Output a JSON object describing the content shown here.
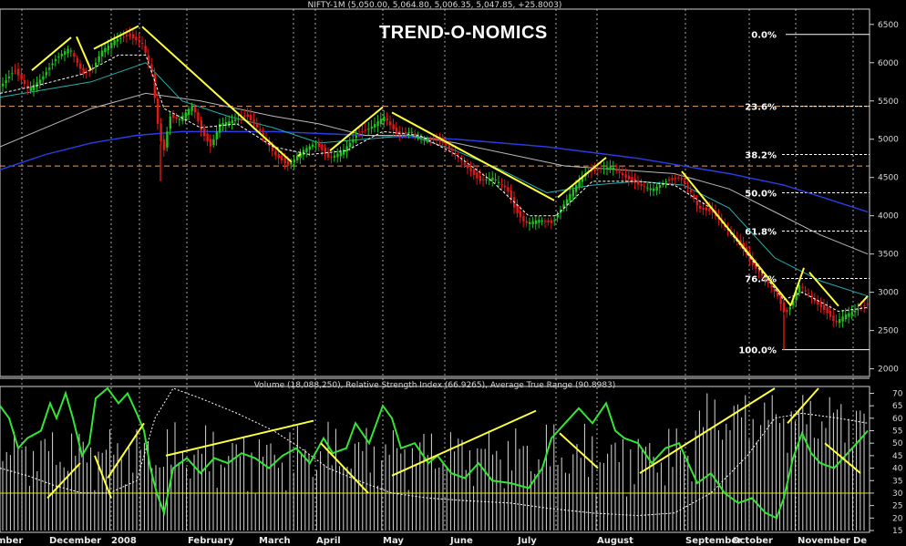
{
  "header": {
    "title": "NIFTY-1M (5,050.00, 5,064.80, 5,006.35, 5,047.85, +25.8003)",
    "brand": "TREND-O-NOMICS"
  },
  "chart_data": [
    {
      "type": "candlestick",
      "name": "price-panel",
      "ylim": [
        1900,
        6700
      ],
      "yticks": [
        2000,
        2500,
        3000,
        3500,
        4000,
        4500,
        5000,
        5500,
        6000,
        6500
      ],
      "x_labels": [
        "mber",
        "December",
        "2008",
        "February",
        "March",
        "April",
        "May",
        "June",
        "July",
        "August",
        "September",
        "October",
        "November",
        "De"
      ],
      "price_path": [
        [
          0,
          5700
        ],
        [
          15,
          5900
        ],
        [
          30,
          5650
        ],
        [
          45,
          5800
        ],
        [
          60,
          6050
        ],
        [
          75,
          6200
        ],
        [
          90,
          5850
        ],
        [
          100,
          5900
        ],
        [
          110,
          6150
        ],
        [
          125,
          6300
        ],
        [
          140,
          6350
        ],
        [
          155,
          6250
        ],
        [
          165,
          5900
        ],
        [
          172,
          5200
        ],
        [
          178,
          4800
        ],
        [
          185,
          5300
        ],
        [
          195,
          5250
        ],
        [
          210,
          5450
        ],
        [
          220,
          5100
        ],
        [
          230,
          4900
        ],
        [
          240,
          5200
        ],
        [
          255,
          5250
        ],
        [
          270,
          5300
        ],
        [
          285,
          5100
        ],
        [
          300,
          4800
        ],
        [
          315,
          4650
        ],
        [
          330,
          4850
        ],
        [
          345,
          4950
        ],
        [
          360,
          4750
        ],
        [
          375,
          4850
        ],
        [
          390,
          5050
        ],
        [
          405,
          5150
        ],
        [
          420,
          5300
        ],
        [
          435,
          5050
        ],
        [
          450,
          5100
        ],
        [
          465,
          5000
        ],
        [
          480,
          5000
        ],
        [
          495,
          4850
        ],
        [
          510,
          4650
        ],
        [
          525,
          4450
        ],
        [
          540,
          4500
        ],
        [
          555,
          4350
        ],
        [
          565,
          4050
        ],
        [
          575,
          3900
        ],
        [
          590,
          3950
        ],
        [
          605,
          3900
        ],
        [
          615,
          4100
        ],
        [
          625,
          4300
        ],
        [
          640,
          4550
        ],
        [
          655,
          4600
        ],
        [
          670,
          4650
        ],
        [
          685,
          4500
        ],
        [
          700,
          4400
        ],
        [
          715,
          4350
        ],
        [
          730,
          4450
        ],
        [
          745,
          4500
        ],
        [
          755,
          4350
        ],
        [
          765,
          4100
        ],
        [
          780,
          4050
        ],
        [
          795,
          3850
        ],
        [
          810,
          3650
        ],
        [
          825,
          3350
        ],
        [
          840,
          3150
        ],
        [
          852,
          2950
        ],
        [
          860,
          2700
        ],
        [
          868,
          2850
        ],
        [
          875,
          3100
        ],
        [
          885,
          3000
        ],
        [
          895,
          2850
        ],
        [
          905,
          2750
        ],
        [
          915,
          2600
        ],
        [
          925,
          2700
        ],
        [
          935,
          2750
        ],
        [
          945,
          2800
        ],
        [
          952,
          2850
        ]
      ],
      "lows": [
        [
          176,
          4450
        ],
        [
          860,
          2250
        ]
      ],
      "ma_short": [
        [
          0,
          5600
        ],
        [
          40,
          5700
        ],
        [
          90,
          5850
        ],
        [
          130,
          6100
        ],
        [
          160,
          6100
        ],
        [
          180,
          5400
        ],
        [
          220,
          5150
        ],
        [
          260,
          5200
        ],
        [
          300,
          4900
        ],
        [
          340,
          4800
        ],
        [
          380,
          4850
        ],
        [
          420,
          5100
        ],
        [
          460,
          5050
        ],
        [
          500,
          4800
        ],
        [
          540,
          4450
        ],
        [
          580,
          4000
        ],
        [
          610,
          4000
        ],
        [
          650,
          4450
        ],
        [
          700,
          4450
        ],
        [
          740,
          4400
        ],
        [
          780,
          4100
        ],
        [
          820,
          3500
        ],
        [
          860,
          2900
        ],
        [
          880,
          3000
        ],
        [
          920,
          2750
        ],
        [
          952,
          2800
        ]
      ],
      "ma_medium": [
        [
          0,
          5550
        ],
        [
          50,
          5650
        ],
        [
          100,
          5750
        ],
        [
          160,
          6000
        ],
        [
          200,
          5500
        ],
        [
          250,
          5300
        ],
        [
          300,
          5150
        ],
        [
          350,
          4950
        ],
        [
          400,
          5000
        ],
        [
          450,
          5050
        ],
        [
          500,
          4850
        ],
        [
          550,
          4600
        ],
        [
          600,
          4300
        ],
        [
          650,
          4400
        ],
        [
          700,
          4450
        ],
        [
          750,
          4400
        ],
        [
          800,
          4100
        ],
        [
          850,
          3450
        ],
        [
          900,
          3150
        ],
        [
          952,
          2950
        ]
      ],
      "ma_long": [
        [
          0,
          4900
        ],
        [
          50,
          5150
        ],
        [
          100,
          5400
        ],
        [
          160,
          5600
        ],
        [
          220,
          5500
        ],
        [
          300,
          5300
        ],
        [
          350,
          5200
        ],
        [
          400,
          5050
        ],
        [
          450,
          5050
        ],
        [
          500,
          4950
        ],
        [
          560,
          4800
        ],
        [
          620,
          4650
        ],
        [
          680,
          4600
        ],
        [
          740,
          4550
        ],
        [
          800,
          4350
        ],
        [
          850,
          4050
        ],
        [
          900,
          3750
        ],
        [
          952,
          3500
        ]
      ],
      "ma_blue": [
        [
          0,
          4600
        ],
        [
          50,
          4800
        ],
        [
          100,
          4950
        ],
        [
          150,
          5050
        ],
        [
          200,
          5100
        ],
        [
          300,
          5100
        ],
        [
          400,
          5050
        ],
        [
          500,
          5000
        ],
        [
          600,
          4900
        ],
        [
          700,
          4750
        ],
        [
          800,
          4550
        ],
        [
          860,
          4400
        ],
        [
          900,
          4250
        ],
        [
          952,
          4050
        ]
      ],
      "fib_levels": [
        {
          "label": "0.0%",
          "price": 6370
        },
        {
          "label": "23.6%",
          "price": 5430
        },
        {
          "label": "38.2%",
          "price": 4800
        },
        {
          "label": "50.0%",
          "price": 4300
        },
        {
          "label": "61.8%",
          "price": 3800
        },
        {
          "label": "76.4%",
          "price": 3180
        },
        {
          "label": "100.0%",
          "price": 2250
        }
      ],
      "dashed_levels": [
        5430,
        4650
      ],
      "trendlines": [
        [
          [
            35,
            5900
          ],
          [
            78,
            6330
          ]
        ],
        [
          [
            84,
            6340
          ],
          [
            100,
            5900
          ]
        ],
        [
          [
            103,
            6180
          ],
          [
            152,
            6480
          ]
        ],
        [
          [
            156,
            6470
          ],
          [
            320,
            4700
          ]
        ],
        [
          [
            330,
            4810
          ],
          [
            327,
            4780
          ]
        ],
        [
          [
            362,
            4850
          ],
          [
            420,
            5420
          ]
        ],
        [
          [
            430,
            5350
          ],
          [
            608,
            4200
          ]
        ],
        [
          [
            612,
            4240
          ],
          [
            665,
            4760
          ]
        ],
        [
          [
            748,
            4580
          ],
          [
            868,
            2820
          ]
        ],
        [
          [
            868,
            2840
          ],
          [
            882,
            3320
          ]
        ],
        [
          [
            888,
            3260
          ],
          [
            920,
            2820
          ]
        ],
        [
          [
            942,
            2820
          ],
          [
            952,
            2950
          ]
        ]
      ]
    },
    {
      "type": "line",
      "name": "indicator-panel",
      "legend": "Volume (18,088,250), Relative Strength Index (66.9265), Average True Range (90.8983)",
      "ylim": [
        15,
        72
      ],
      "yticks": [
        15,
        20,
        25,
        30,
        35,
        40,
        45,
        50,
        55,
        60,
        65,
        70
      ],
      "rsi": [
        [
          0,
          65
        ],
        [
          10,
          60
        ],
        [
          20,
          48
        ],
        [
          30,
          52
        ],
        [
          45,
          55
        ],
        [
          55,
          66
        ],
        [
          62,
          60
        ],
        [
          72,
          70
        ],
        [
          80,
          60
        ],
        [
          90,
          45
        ],
        [
          98,
          50
        ],
        [
          105,
          68
        ],
        [
          118,
          72
        ],
        [
          130,
          66
        ],
        [
          140,
          70
        ],
        [
          150,
          62
        ],
        [
          158,
          55
        ],
        [
          165,
          40
        ],
        [
          172,
          30
        ],
        [
          180,
          22
        ],
        [
          190,
          40
        ],
        [
          205,
          44
        ],
        [
          220,
          38
        ],
        [
          235,
          44
        ],
        [
          250,
          42
        ],
        [
          265,
          46
        ],
        [
          280,
          44
        ],
        [
          295,
          40
        ],
        [
          310,
          45
        ],
        [
          325,
          48
        ],
        [
          340,
          42
        ],
        [
          355,
          52
        ],
        [
          365,
          46
        ],
        [
          380,
          48
        ],
        [
          390,
          58
        ],
        [
          405,
          50
        ],
        [
          420,
          65
        ],
        [
          430,
          60
        ],
        [
          440,
          48
        ],
        [
          455,
          50
        ],
        [
          470,
          42
        ],
        [
          480,
          45
        ],
        [
          495,
          38
        ],
        [
          510,
          36
        ],
        [
          525,
          42
        ],
        [
          540,
          35
        ],
        [
          560,
          34
        ],
        [
          580,
          32
        ],
        [
          595,
          40
        ],
        [
          605,
          52
        ],
        [
          615,
          56
        ],
        [
          625,
          60
        ],
        [
          635,
          64
        ],
        [
          650,
          58
        ],
        [
          665,
          66
        ],
        [
          675,
          55
        ],
        [
          685,
          52
        ],
        [
          700,
          50
        ],
        [
          715,
          42
        ],
        [
          730,
          48
        ],
        [
          745,
          50
        ],
        [
          755,
          42
        ],
        [
          765,
          34
        ],
        [
          780,
          38
        ],
        [
          795,
          30
        ],
        [
          810,
          26
        ],
        [
          825,
          28
        ],
        [
          840,
          22
        ],
        [
          852,
          20
        ],
        [
          860,
          28
        ],
        [
          870,
          44
        ],
        [
          880,
          54
        ],
        [
          890,
          46
        ],
        [
          900,
          42
        ],
        [
          915,
          40
        ],
        [
          925,
          44
        ],
        [
          935,
          48
        ],
        [
          945,
          52
        ],
        [
          952,
          55
        ]
      ],
      "atr": [
        [
          0,
          40
        ],
        [
          30,
          37
        ],
        [
          60,
          33
        ],
        [
          90,
          30
        ],
        [
          120,
          30
        ],
        [
          150,
          35
        ],
        [
          170,
          60
        ],
        [
          190,
          72
        ],
        [
          220,
          68
        ],
        [
          260,
          62
        ],
        [
          300,
          55
        ],
        [
          330,
          48
        ],
        [
          360,
          40
        ],
        [
          400,
          34
        ],
        [
          430,
          30
        ],
        [
          470,
          28
        ],
        [
          510,
          27
        ],
        [
          560,
          26
        ],
        [
          600,
          24
        ],
        [
          650,
          22
        ],
        [
          700,
          21
        ],
        [
          740,
          22
        ],
        [
          780,
          30
        ],
        [
          820,
          45
        ],
        [
          850,
          60
        ],
        [
          880,
          62
        ],
        [
          920,
          60
        ],
        [
          952,
          58
        ]
      ],
      "rsi_level": 30,
      "trendlines": [
        [
          [
            52,
            28
          ],
          [
            88,
            42
          ]
        ],
        [
          [
            104,
            45
          ],
          [
            122,
            28
          ]
        ],
        [
          [
            118,
            36
          ],
          [
            158,
            58
          ]
        ],
        [
          [
            182,
            45
          ],
          [
            344,
            59
          ]
        ],
        [
          [
            352,
            50
          ],
          [
            404,
            30
          ]
        ],
        [
          [
            430,
            37
          ],
          [
            588,
            63
          ]
        ],
        [
          [
            614,
            54
          ],
          [
            656,
            40
          ]
        ],
        [
          [
            702,
            38
          ],
          [
            850,
            72
          ]
        ],
        [
          [
            864,
            58
          ],
          [
            898,
            72
          ]
        ],
        [
          [
            905,
            50
          ],
          [
            944,
            38
          ]
        ]
      ]
    }
  ],
  "colors": {
    "background": "#000000",
    "up_candle": "#1fc21f",
    "down_candle": "#e01818",
    "ma_short": "#ffffff",
    "ma_medium": "#22b0b0",
    "ma_long": "#b8b8b8",
    "ma_blue": "#2a3ee8",
    "trendline": "#ffff3a",
    "rsi": "#33e633",
    "atr": "#ffffff",
    "volume": "#ffffff",
    "grid": "#e0e0e0",
    "fib": "#ffffff",
    "dashed_level": "#e0a060",
    "rsi_level": "#e0e000"
  }
}
